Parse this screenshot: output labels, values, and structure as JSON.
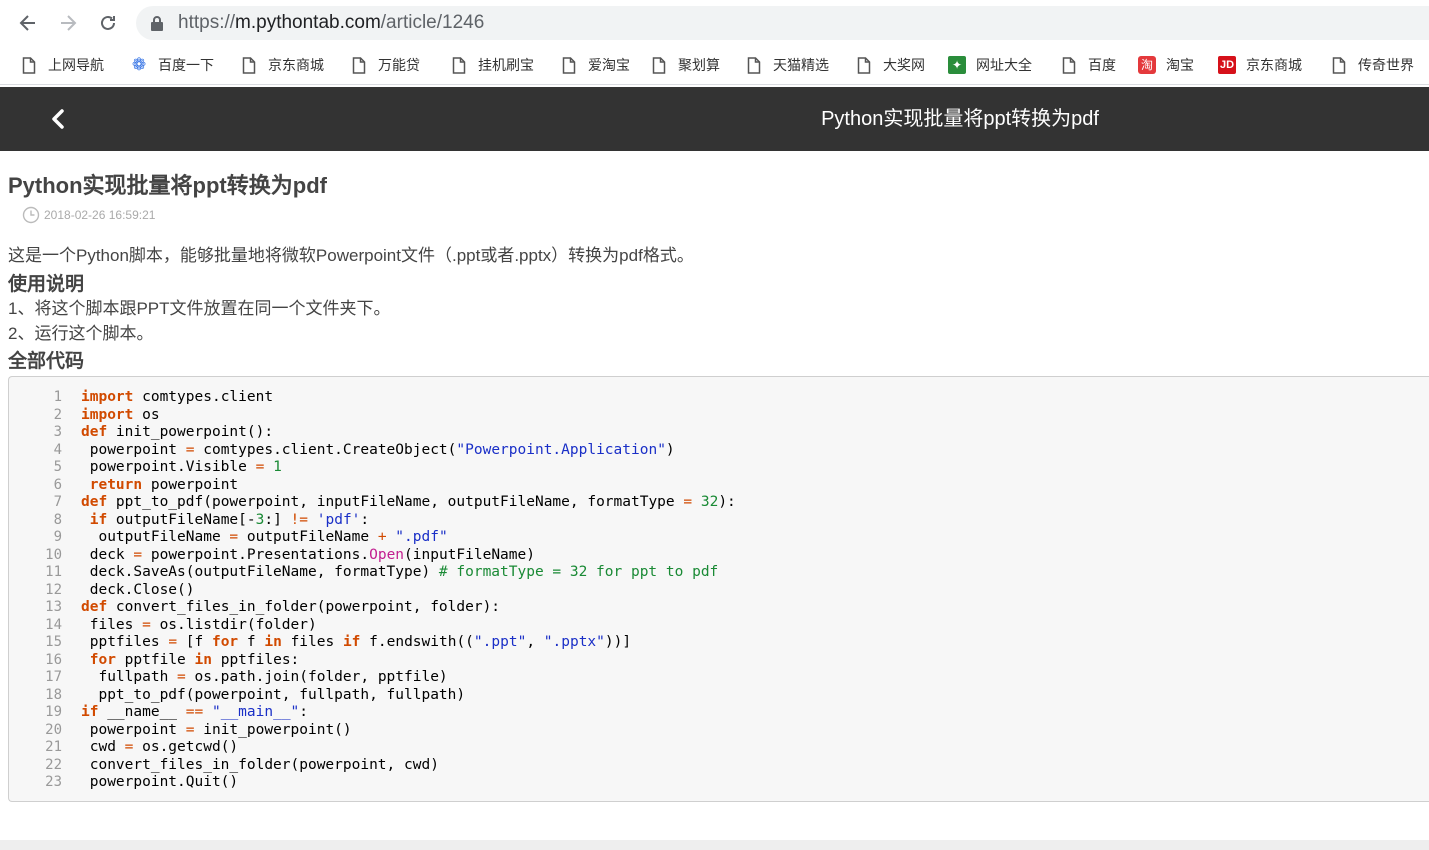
{
  "browser": {
    "url_scheme": "https://",
    "url_host": "m.pythontab.com",
    "url_path": "/article/1246",
    "bookmarks": [
      {
        "label": "上网导航",
        "icon": "page-icon"
      },
      {
        "label": "百度一下",
        "icon": "baidu-paw-icon"
      },
      {
        "label": "京东商城",
        "icon": "page-icon"
      },
      {
        "label": "万能贷",
        "icon": "page-icon"
      },
      {
        "label": "挂机刷宝",
        "icon": "page-icon"
      },
      {
        "label": "爱淘宝",
        "icon": "page-icon"
      },
      {
        "label": "聚划算",
        "icon": "page-icon"
      },
      {
        "label": "天猫精选",
        "icon": "page-icon"
      },
      {
        "label": "大奖网",
        "icon": "page-icon"
      },
      {
        "label": "网址大全",
        "icon": "grid-logo-icon"
      },
      {
        "label": "百度",
        "icon": "page-icon"
      },
      {
        "label": "淘宝",
        "icon": "taobao-icon",
        "glyph": "淘"
      },
      {
        "label": "京东商城",
        "icon": "jd-icon",
        "glyph": "JD"
      },
      {
        "label": "传奇世界",
        "icon": "page-icon"
      }
    ]
  },
  "header": {
    "title": "Python实现批量将ppt转换为pdf"
  },
  "article": {
    "title": "Python实现批量将ppt转换为pdf",
    "date": "2018-02-26 16:59:21",
    "intro": "这是一个Python脚本，能够批量地将微软Powerpoint文件（.ppt或者.pptx）转换为pdf格式。",
    "usage_heading": "使用说明",
    "step1": "1、将这个脚本跟PPT文件放置在同一个文件夹下。",
    "step2": "2、运行这个脚本。",
    "code_heading": "全部代码"
  },
  "code_lines": [
    "import comtypes.client",
    "import os",
    "def init_powerpoint():",
    " powerpoint = comtypes.client.CreateObject(\"Powerpoint.Application\")",
    " powerpoint.Visible = 1",
    " return powerpoint",
    "def ppt_to_pdf(powerpoint, inputFileName, outputFileName, formatType = 32):",
    " if outputFileName[-3:] != 'pdf':",
    "  outputFileName = outputFileName + \".pdf\"",
    " deck = powerpoint.Presentations.Open(inputFileName)",
    " deck.SaveAs(outputFileName, formatType) # formatType = 32 for ppt to pdf",
    " deck.Close()",
    "def convert_files_in_folder(powerpoint, folder):",
    " files = os.listdir(folder)",
    " pptfiles = [f for f in files if f.endswith((\".ppt\", \".pptx\"))]",
    " for pptfile in pptfiles:",
    "  fullpath = os.path.join(folder, pptfile)",
    "  ppt_to_pdf(powerpoint, fullpath, fullpath)",
    "if __name__ == \"__main__\":",
    " powerpoint = init_powerpoint()",
    " cwd = os.getcwd()",
    " convert_files_in_folder(powerpoint, cwd)",
    " powerpoint.Quit()"
  ]
}
